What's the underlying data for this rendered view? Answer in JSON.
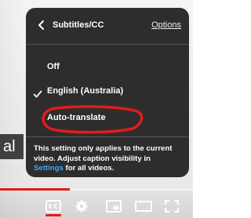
{
  "caption_fragment": "al",
  "panel": {
    "title": "Subtitles/CC",
    "options_label": "Options",
    "items": [
      {
        "label": "Off",
        "selected": false
      },
      {
        "label": "English (Australia)",
        "selected": true
      },
      {
        "label": "Auto-translate",
        "selected": false
      }
    ],
    "footer": {
      "text_before": "This setting only applies to the current video. Adjust caption visibility in ",
      "link": "Settings",
      "text_after": " for all videos."
    }
  },
  "progress": {
    "watched_fraction": 0.36
  },
  "controls": {
    "icons": [
      "subtitles-icon",
      "settings-icon",
      "miniplayer-icon",
      "theater-mode-icon",
      "fullscreen-icon"
    ]
  },
  "colors": {
    "accent_red": "#e21b1b",
    "link_blue": "#3ea6ff",
    "panel_bg": "#1c1c1c"
  }
}
